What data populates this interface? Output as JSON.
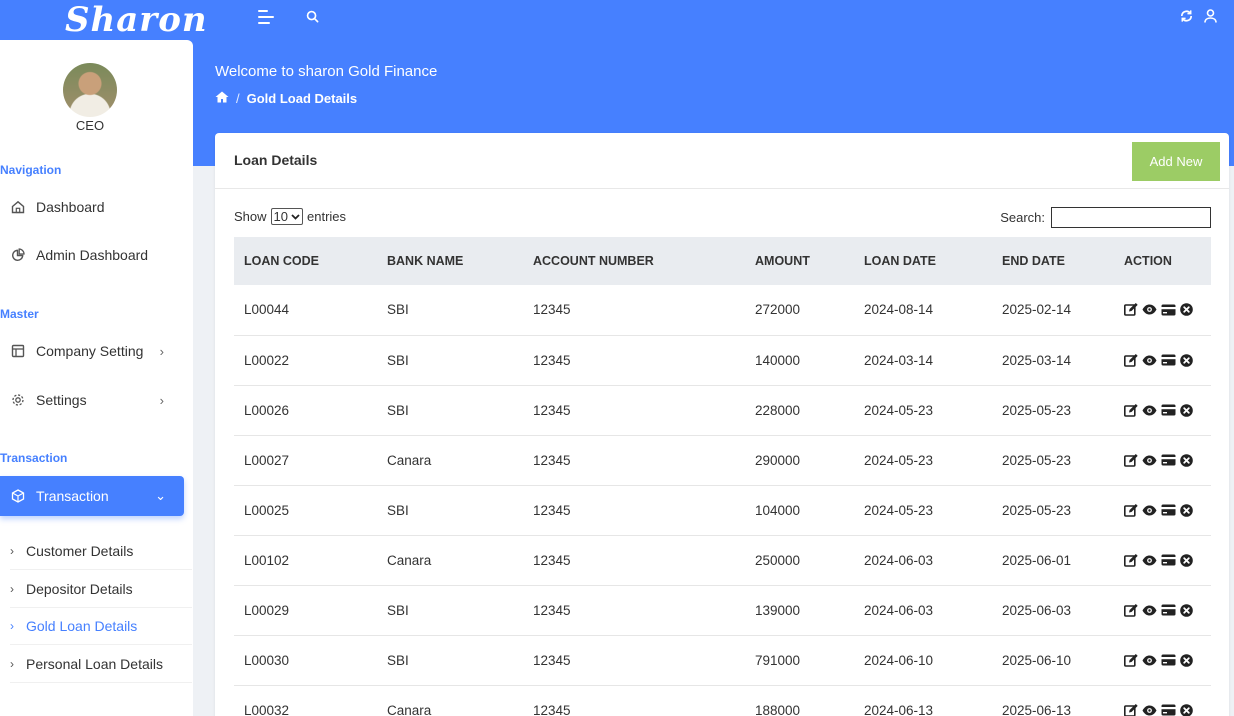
{
  "brand": "Sharon",
  "user": {
    "role": "CEO"
  },
  "sidebar": {
    "groups": [
      "Navigation",
      "Master",
      "Transaction"
    ],
    "items": [
      {
        "label": "Dashboard",
        "icon": "home-icon"
      },
      {
        "label": "Admin Dashboard",
        "icon": "pie-chart-icon"
      },
      {
        "label": "Company Setting",
        "icon": "layout-icon"
      },
      {
        "label": "Settings",
        "icon": "gear-icon"
      },
      {
        "label": "Transaction",
        "icon": "box-icon"
      }
    ],
    "subitems": [
      "Customer Details",
      "Depositor Details",
      "Gold Loan Details",
      "Personal Loan Details"
    ]
  },
  "header": {
    "welcome": "Welcome to sharon Gold Finance",
    "breadcrumb": "Gold Load Details"
  },
  "card": {
    "title": "Loan Details",
    "add_label": "Add New",
    "show_label": "Show",
    "entries_value": "10",
    "entries_label": "entries",
    "search_label": "Search:"
  },
  "colors": {
    "accent": "#4680ff",
    "add_button": "#9ccc65",
    "header_row": "#e9ecf0"
  },
  "table": {
    "columns": [
      "LOAN CODE",
      "BANK NAME",
      "ACCOUNT NUMBER",
      "AMOUNT",
      "LOAN DATE",
      "END DATE",
      "ACTION"
    ],
    "rows": [
      [
        "L00044",
        "SBI",
        "12345",
        "272000",
        "2024-08-14",
        "2025-02-14"
      ],
      [
        "L00022",
        "SBI",
        "12345",
        "140000",
        "2024-03-14",
        "2025-03-14"
      ],
      [
        "L00026",
        "SBI",
        "12345",
        "228000",
        "2024-05-23",
        "2025-05-23"
      ],
      [
        "L00027",
        "Canara",
        "12345",
        "290000",
        "2024-05-23",
        "2025-05-23"
      ],
      [
        "L00025",
        "SBI",
        "12345",
        "104000",
        "2024-05-23",
        "2025-05-23"
      ],
      [
        "L00102",
        "Canara",
        "12345",
        "250000",
        "2024-06-03",
        "2025-06-01"
      ],
      [
        "L00029",
        "SBI",
        "12345",
        "139000",
        "2024-06-03",
        "2025-06-03"
      ],
      [
        "L00030",
        "SBI",
        "12345",
        "791000",
        "2024-06-10",
        "2025-06-10"
      ],
      [
        "L00032",
        "Canara",
        "12345",
        "188000",
        "2024-06-13",
        "2025-06-13"
      ]
    ]
  }
}
